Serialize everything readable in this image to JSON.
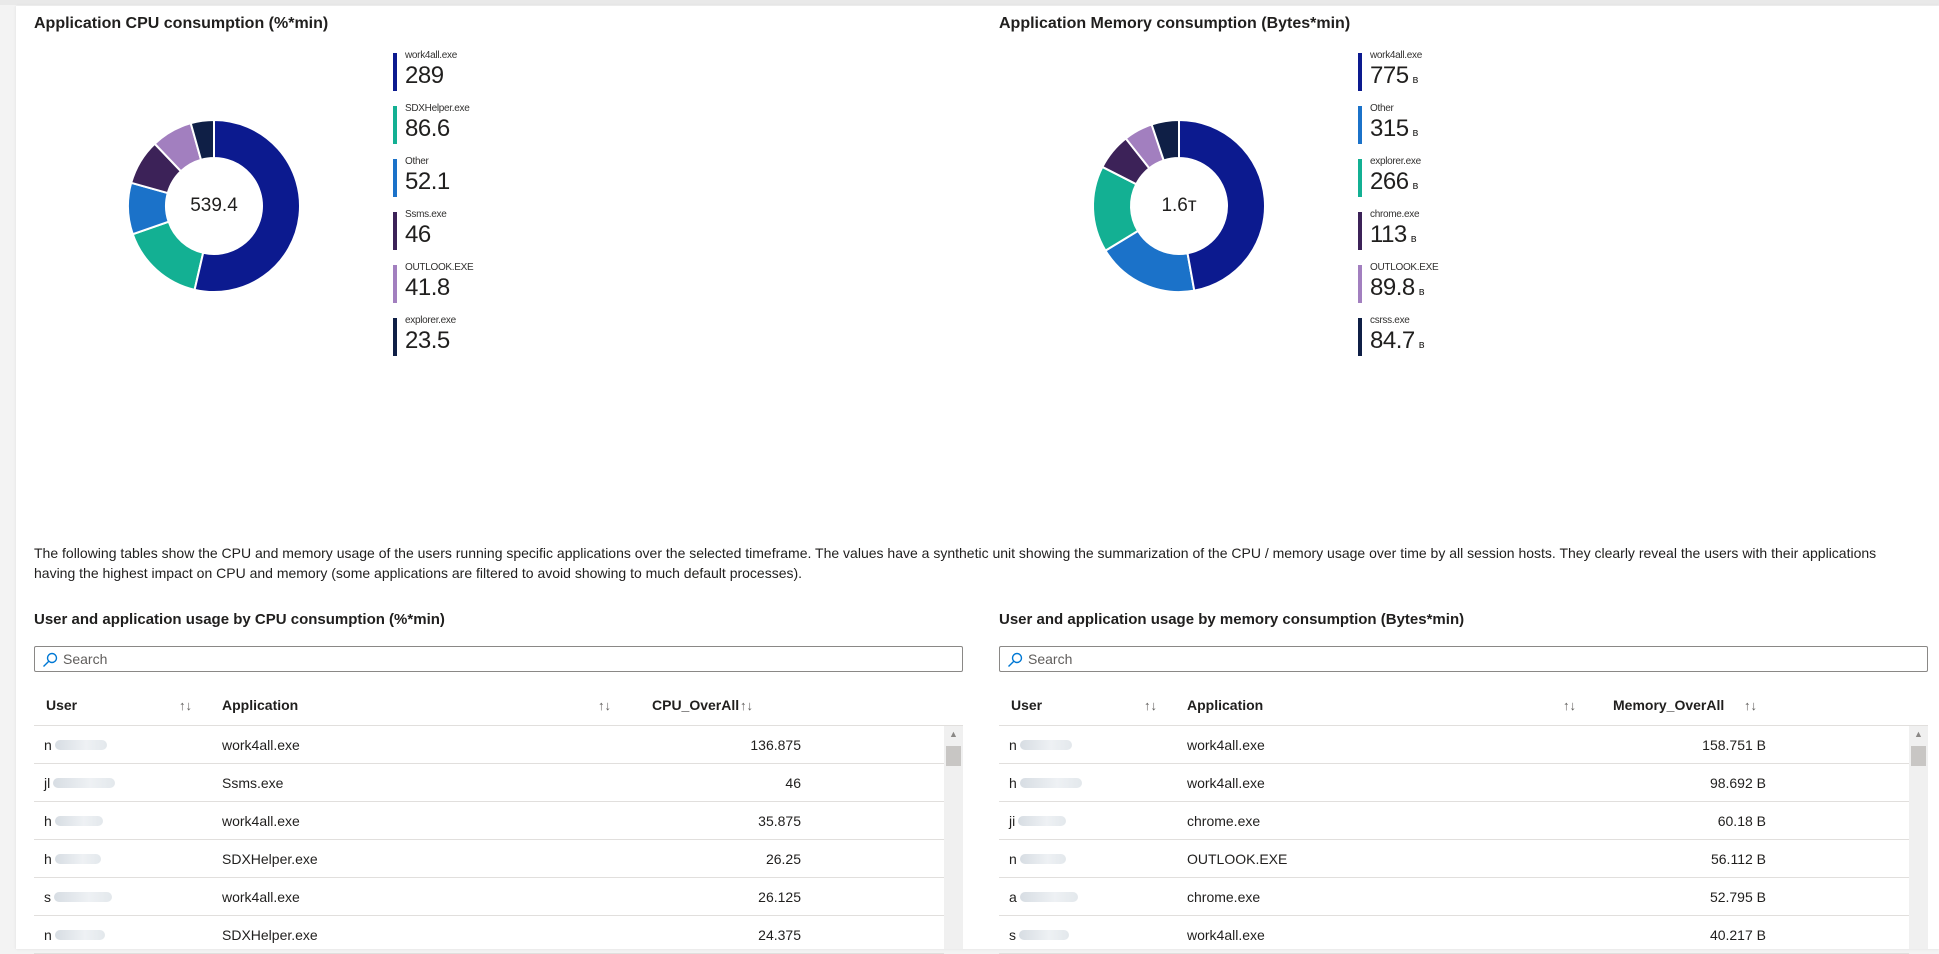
{
  "cpu_chart": {
    "title": "Application CPU consumption (%*min)",
    "center_label": "539.4",
    "items": [
      {
        "name": "work4all.exe",
        "display": "289",
        "unit": "",
        "value": 289,
        "color": "#0c1a8f"
      },
      {
        "name": "SDXHelper.exe",
        "display": "86.6",
        "unit": "",
        "value": 86.6,
        "color": "#13b093"
      },
      {
        "name": "Other",
        "display": "52.1",
        "unit": "",
        "value": 52.1,
        "color": "#1b72c9"
      },
      {
        "name": "Ssms.exe",
        "display": "46",
        "unit": "",
        "value": 46,
        "color": "#3c2258"
      },
      {
        "name": "OUTLOOK.EXE",
        "display": "41.8",
        "unit": "",
        "value": 41.8,
        "color": "#a27fbf"
      },
      {
        "name": "explorer.exe",
        "display": "23.5",
        "unit": "",
        "value": 23.5,
        "color": "#0f1f46"
      }
    ]
  },
  "memory_chart": {
    "title": "Application Memory consumption (Bytes*min)",
    "center_label": "1.6т",
    "items": [
      {
        "name": "work4all.exe",
        "display": "775",
        "unit": "в",
        "value": 775,
        "color": "#0c1a8f"
      },
      {
        "name": "Other",
        "display": "315",
        "unit": "в",
        "value": 315,
        "color": "#1b72c9"
      },
      {
        "name": "explorer.exe",
        "display": "266",
        "unit": "в",
        "value": 266,
        "color": "#13b093"
      },
      {
        "name": "chrome.exe",
        "display": "113",
        "unit": "в",
        "value": 113,
        "color": "#3c2258"
      },
      {
        "name": "OUTLOOK.EXE",
        "display": "89.8",
        "unit": "в",
        "value": 89.8,
        "color": "#a27fbf"
      },
      {
        "name": "csrss.exe",
        "display": "84.7",
        "unit": "в",
        "value": 84.7,
        "color": "#0f1f46"
      }
    ]
  },
  "description": "The following tables show the CPU and memory usage of the users running specific applications over the selected timeframe. The values have a synthetic unit showing the summarization of the CPU / memory usage over time by all session hosts. They clearly reveal the users with their applications having the highest impact on CPU and memory (some applications are filtered to avoid showing to much default processes).",
  "cpu_table": {
    "title": "User and application usage by CPU consumption (%*min)",
    "search_placeholder": "Search",
    "columns": {
      "user": "User",
      "application": "Application",
      "value": "CPU_OverAll"
    },
    "sort_icon": "↑↓",
    "rows": [
      {
        "user": "n",
        "application": "work4all.exe",
        "value": "136.875"
      },
      {
        "user": "jl",
        "application": "Ssms.exe",
        "value": "46"
      },
      {
        "user": "h",
        "application": "work4all.exe",
        "value": "35.875"
      },
      {
        "user": "h",
        "application": "SDXHelper.exe",
        "value": "26.25"
      },
      {
        "user": "s",
        "application": "work4all.exe",
        "value": "26.125"
      },
      {
        "user": "n",
        "application": "SDXHelper.exe",
        "value": "24.375"
      }
    ]
  },
  "memory_table": {
    "title": "User and application usage by memory consumption (Bytes*min)",
    "search_placeholder": "Search",
    "columns": {
      "user": "User",
      "application": "Application",
      "value": "Memory_OverAll"
    },
    "sort_icon": "↑↓",
    "rows": [
      {
        "user": "n",
        "application": "work4all.exe",
        "value": "158.751 B"
      },
      {
        "user": "h",
        "application": "work4all.exe",
        "value": "98.692 B"
      },
      {
        "user": "ji",
        "application": "chrome.exe",
        "value": "60.18 B"
      },
      {
        "user": "n",
        "application": "OUTLOOK.EXE",
        "value": "56.112 B"
      },
      {
        "user": "a",
        "application": "chrome.exe",
        "value": "52.795 B"
      },
      {
        "user": "s",
        "application": "work4all.exe",
        "value": "40.217 B"
      }
    ]
  }
}
